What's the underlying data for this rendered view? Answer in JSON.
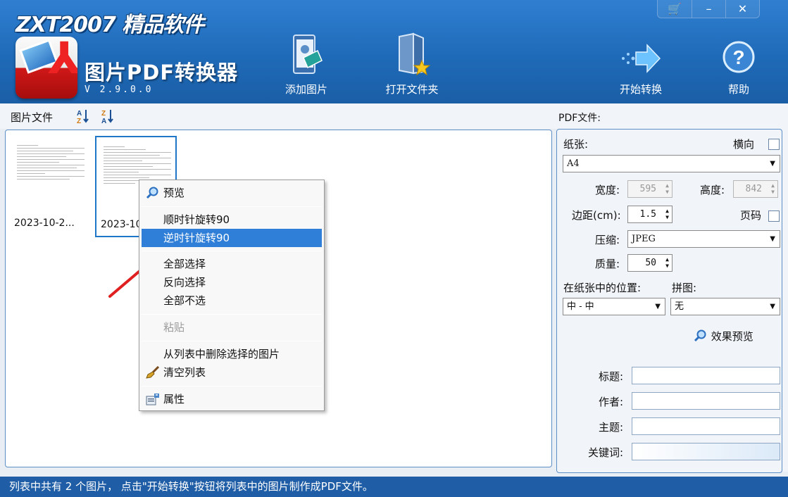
{
  "window": {
    "brand": "ZXT2007 精品软件",
    "app_title": "图片PDF转换器",
    "version": "V 2.9.0.0",
    "controls": {
      "cart": "🛒",
      "minimize": "–",
      "close": "✕"
    }
  },
  "toolbar": {
    "add_images": "添加图片",
    "open_folder": "打开文件夹",
    "start_convert": "开始转换",
    "help": "帮助"
  },
  "list": {
    "header_label": "图片文件",
    "sort_asc": "A\nZ",
    "sort_desc": "Z\nA",
    "items": [
      {
        "caption": "2023-10-2...",
        "selected": false
      },
      {
        "caption": "2023-10",
        "selected": true
      }
    ]
  },
  "context_menu": {
    "items": [
      {
        "label": "预览",
        "icon": "magnifier-icon"
      },
      {
        "label": "顺时针旋转90"
      },
      {
        "label": "逆时针旋转90",
        "highlighted": true
      },
      {
        "label": "全部选择"
      },
      {
        "label": "反向选择"
      },
      {
        "label": "全部不选"
      },
      {
        "label": "粘贴",
        "disabled": true
      },
      {
        "label": "从列表中删除选择的图片"
      },
      {
        "label": "清空列表",
        "icon": "broom-icon"
      },
      {
        "label": "属性",
        "icon": "properties-icon"
      }
    ]
  },
  "pdf": {
    "section_title": "PDF文件:",
    "paper_label": "纸张:",
    "landscape_label": "横向",
    "paper_value": "A4",
    "width_label": "宽度:",
    "width_value": "595",
    "height_label": "高度:",
    "height_value": "842",
    "margin_label": "边距(cm):",
    "margin_value": "1.5",
    "page_number_label": "页码",
    "compress_label": "压缩:",
    "compress_value": "JPEG",
    "quality_label": "质量:",
    "quality_value": "50",
    "position_label": "在纸张中的位置:",
    "position_value": "中 - 中",
    "tile_label": "拼图:",
    "tile_value": "无",
    "preview_effect": "效果预览",
    "meta_title_label": "标题:",
    "meta_author_label": "作者:",
    "meta_subject_label": "主题:",
    "meta_keywords_label": "关键词:"
  },
  "status": {
    "text": "列表中共有 2 个图片， 点击\"开始转换\"按钮将列表中的图片制作成PDF文件。"
  },
  "colors": {
    "header_blue": "#1f6ab8",
    "status_blue": "#1f5ea6",
    "highlight": "#2f7ed8",
    "arrow_red": "#e02020"
  }
}
